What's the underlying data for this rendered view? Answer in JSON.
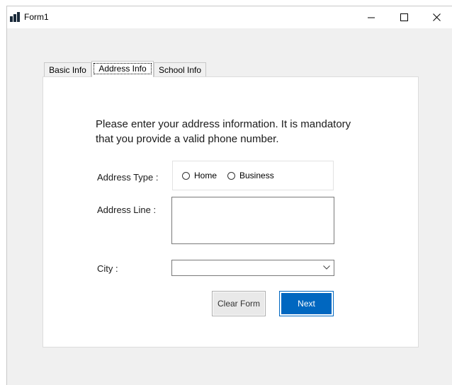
{
  "window": {
    "title": "Form1",
    "icons": {
      "app": "form-app-icon",
      "minimize": "minimize-icon",
      "maximize": "maximize-icon",
      "close": "close-icon"
    }
  },
  "tabs": [
    {
      "label": "Basic Info",
      "active": false
    },
    {
      "label": "Address Info",
      "active": true
    },
    {
      "label": "School Info",
      "active": false
    }
  ],
  "form": {
    "instructions_line1": "Please enter your address information. It is mandatory",
    "instructions_line2": "that you provide a valid phone  number.",
    "address_type_label": "Address Type :",
    "address_type_options": [
      {
        "label": "Home",
        "selected": false
      },
      {
        "label": "Business",
        "selected": false
      }
    ],
    "address_line_label": "Address Line :",
    "address_line_value": "",
    "city_label": "City :",
    "city_selected": "",
    "clear_button": "Clear Form",
    "next_button": "Next"
  },
  "colors": {
    "accent": "#0067c0",
    "window_bg": "#f0f0f0",
    "panel_bg": "#ffffff"
  }
}
